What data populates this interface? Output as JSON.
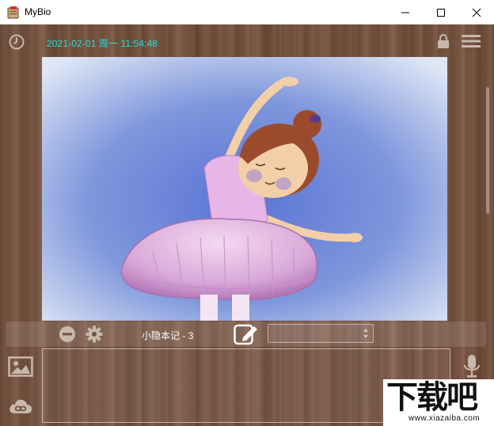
{
  "window": {
    "title": "MyBio",
    "controls": [
      "minimize",
      "maximize",
      "close"
    ]
  },
  "header": {
    "datetime": "2021-02-01 周一 11:54:48",
    "icons": [
      "clock-icon",
      "lock-icon",
      "menu-icon"
    ]
  },
  "photo": {
    "subject": "ballerina-illustration"
  },
  "toolbar": {
    "note_title": "小隐本记 - 3",
    "select_value": "",
    "icons": [
      "minus-circle-icon",
      "gear-icon",
      "edit-icon",
      "updown-arrows-icon"
    ]
  },
  "composer": {
    "text_value": "",
    "icons": [
      "image-icon",
      "cloud-icon",
      "microphone-icon"
    ]
  },
  "watermark": {
    "big_text": "下载吧",
    "small_text": "www.xiazaiba.com"
  },
  "colors": {
    "accent_time": "#22e0e0",
    "wood": "#74513f"
  }
}
